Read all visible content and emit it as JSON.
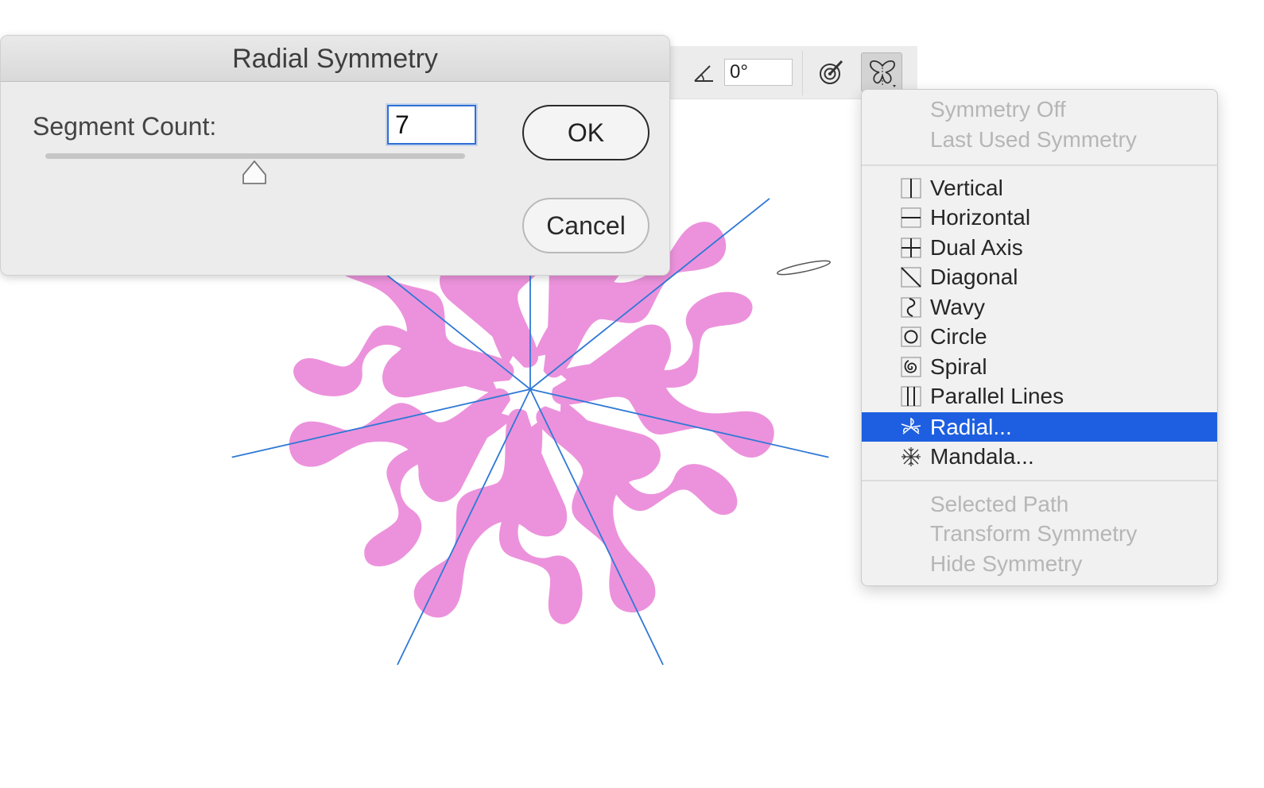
{
  "dialog": {
    "title": "Radial Symmetry",
    "segment_label": "Segment Count:",
    "segment_value": "7",
    "slider_level": 0.5,
    "ok_label": "OK",
    "cancel_label": "Cancel"
  },
  "toolbar": {
    "angle_value": "0°",
    "angle_icon": "angle-icon",
    "paint_icon": "paint-target-icon",
    "symmetry_icon": "butterfly-icon"
  },
  "menu": {
    "top_items": [
      "Symmetry Off",
      "Last Used Symmetry"
    ],
    "symmetry_items": [
      {
        "label": "Vertical",
        "icon": "vertical-icon"
      },
      {
        "label": "Horizontal",
        "icon": "horizontal-icon"
      },
      {
        "label": "Dual Axis",
        "icon": "dual-axis-icon"
      },
      {
        "label": "Diagonal",
        "icon": "diagonal-icon"
      },
      {
        "label": "Wavy",
        "icon": "wavy-icon"
      },
      {
        "label": "Circle",
        "icon": "circle-icon"
      },
      {
        "label": "Spiral",
        "icon": "spiral-icon"
      },
      {
        "label": "Parallel Lines",
        "icon": "parallel-lines-icon"
      },
      {
        "label": "Radial...",
        "icon": "radial-icon",
        "selected": true
      },
      {
        "label": "Mandala...",
        "icon": "mandala-icon"
      }
    ],
    "bottom_items": [
      "Selected Path",
      "Transform Symmetry",
      "Hide Symmetry"
    ]
  },
  "colors": {
    "stroke": "#ec92dc",
    "guide_line": "#2f79d6",
    "selection": "#1d5fe0",
    "dialog_bg": "#ececec",
    "menu_bg": "#f1f1f1"
  },
  "canvas": {
    "segments": 7
  }
}
